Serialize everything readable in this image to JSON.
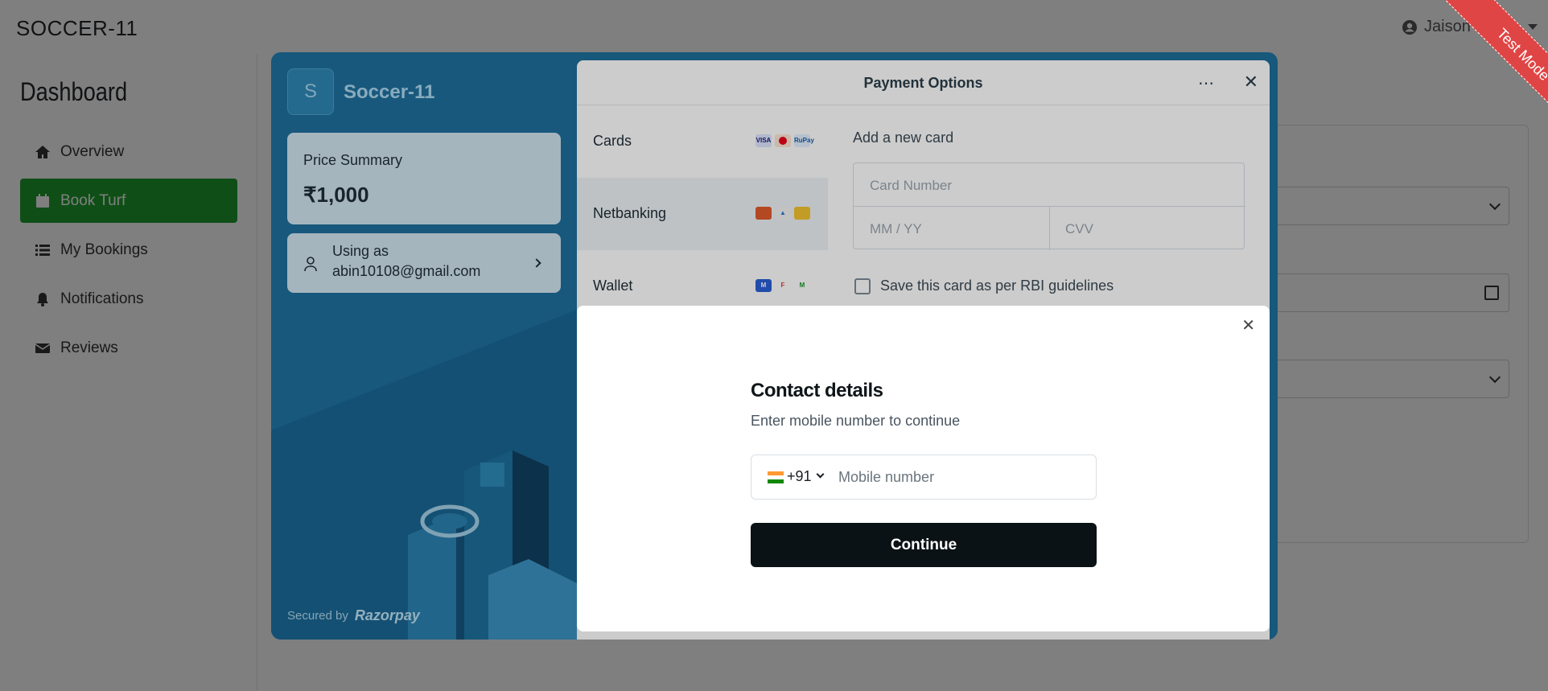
{
  "app": {
    "brand": "SOCCER-11",
    "user_name": "Jaison Samy"
  },
  "sidebar": {
    "title": "Dashboard",
    "items": [
      {
        "label": "Overview",
        "icon": "home-icon"
      },
      {
        "label": "Book Turf",
        "icon": "calendar-icon",
        "active": true
      },
      {
        "label": "My Bookings",
        "icon": "list-icon"
      },
      {
        "label": "Notifications",
        "icon": "bell-icon"
      },
      {
        "label": "Reviews",
        "icon": "envelope-icon"
      }
    ]
  },
  "ribbon": {
    "label": "Test Mode"
  },
  "checkout": {
    "merchant_initial": "S",
    "merchant_name": "Soccer-11",
    "price_label": "Price Summary",
    "price_value": "₹1,000",
    "user_label": "Using as",
    "user_email": "abin10108@gmail.com",
    "secured_by": "Secured by",
    "provider": "Razorpay",
    "title": "Payment Options",
    "methods": [
      {
        "label": "Cards"
      },
      {
        "label": "Netbanking"
      },
      {
        "label": "Wallet"
      }
    ],
    "add_card_label": "Add a new card",
    "card_number_placeholder": "Card Number",
    "expiry_placeholder": "MM / YY",
    "cvv_placeholder": "CVV",
    "save_card_label": "Save this card as per RBI guidelines"
  },
  "contact_dialog": {
    "title": "Contact details",
    "subtitle": "Enter mobile number to continue",
    "country_code": "+91",
    "mobile_placeholder": "Mobile number",
    "continue_label": "Continue"
  },
  "colors": {
    "active_nav": "#1f9e2e",
    "checkout_theme": "#1f6f9c",
    "ribbon": "#e04545",
    "continue_button": "#0b1216"
  }
}
